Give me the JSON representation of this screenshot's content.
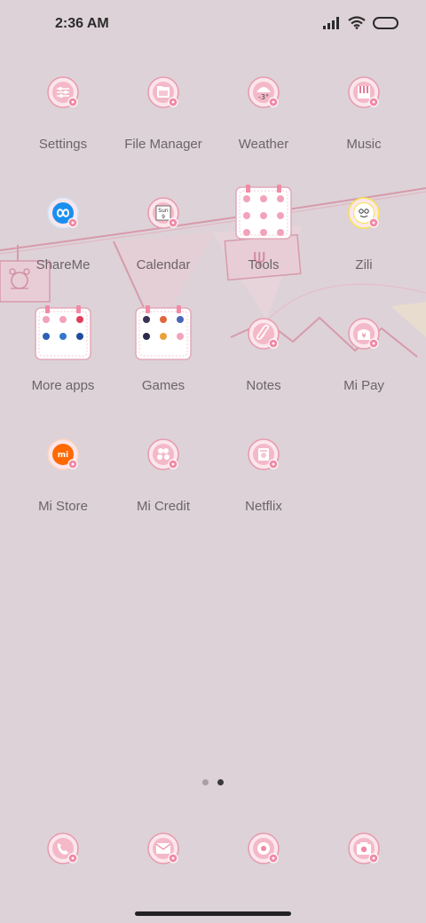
{
  "status": {
    "time": "2:36 AM"
  },
  "apps": [
    {
      "label": "Settings",
      "icon": "settings-icon"
    },
    {
      "label": "File Manager",
      "icon": "folder-icon"
    },
    {
      "label": "Weather",
      "icon": "weather-icon",
      "temp": "-3°"
    },
    {
      "label": "Music",
      "icon": "music-icon"
    },
    {
      "label": "ShareMe",
      "icon": "shareme-icon"
    },
    {
      "label": "Calendar",
      "icon": "calendar-icon",
      "day": "Sun",
      "date": "9"
    },
    {
      "label": "Tools",
      "icon": "tools-folder-icon"
    },
    {
      "label": "Zili",
      "icon": "zili-icon"
    },
    {
      "label": "More apps",
      "icon": "more-apps-folder-icon"
    },
    {
      "label": "Games",
      "icon": "games-folder-icon"
    },
    {
      "label": "Notes",
      "icon": "notes-icon"
    },
    {
      "label": "Mi Pay",
      "icon": "mi-pay-icon",
      "symbol": "¥"
    },
    {
      "label": "Mi Store",
      "icon": "mi-store-icon",
      "symbol": "mi"
    },
    {
      "label": "Mi Credit",
      "icon": "mi-credit-icon"
    },
    {
      "label": "Netflix",
      "icon": "netflix-icon"
    }
  ],
  "dock": [
    {
      "icon": "phone-icon"
    },
    {
      "icon": "messages-icon"
    },
    {
      "icon": "browser-icon"
    },
    {
      "icon": "camera-icon"
    }
  ],
  "pager": {
    "pages": 2,
    "current": 2
  },
  "colors": {
    "background": "#ddd2d7",
    "icon_pink": "#f4b9c9",
    "icon_ring": "#e799ae",
    "label": "#6b6468",
    "shareme_blue": "#1b8ff0",
    "mi_orange": "#ff6900",
    "zili_yellow": "#f7e54a"
  }
}
